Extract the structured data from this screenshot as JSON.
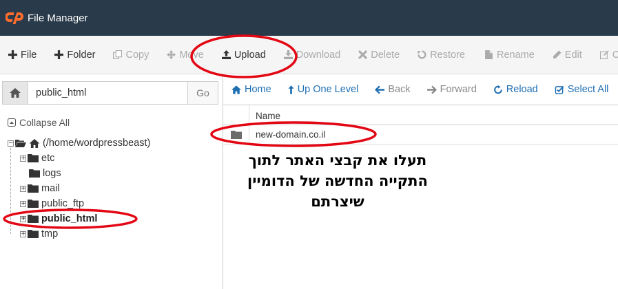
{
  "app": {
    "title": "File Manager",
    "logo_icon": "cpanel-logo"
  },
  "toolbar": {
    "items": [
      {
        "label": "File",
        "icon": "plus-icon",
        "enabled": true
      },
      {
        "label": "Folder",
        "icon": "plus-icon",
        "enabled": true
      },
      {
        "label": "Copy",
        "icon": "copy-icon",
        "enabled": false
      },
      {
        "label": "Move",
        "icon": "move-icon",
        "enabled": false
      },
      {
        "label": "Upload",
        "icon": "upload-icon",
        "enabled": true
      },
      {
        "label": "Download",
        "icon": "download-icon",
        "enabled": false
      },
      {
        "label": "Delete",
        "icon": "delete-icon",
        "enabled": false
      },
      {
        "label": "Restore",
        "icon": "restore-icon",
        "enabled": false
      },
      {
        "label": "Rename",
        "icon": "rename-icon",
        "enabled": false
      },
      {
        "label": "Edit",
        "icon": "edit-icon",
        "enabled": false
      },
      {
        "label": "Co",
        "icon": "code-icon",
        "enabled": false
      }
    ]
  },
  "path": {
    "value": "public_html",
    "go_label": "Go"
  },
  "tree": {
    "collapse_label": "Collapse All",
    "root_label": "(/home/wordpressbeast)",
    "items": [
      {
        "label": "etc",
        "expandable": true,
        "selected": false
      },
      {
        "label": "logs",
        "expandable": false,
        "selected": false
      },
      {
        "label": "mail",
        "expandable": true,
        "selected": false
      },
      {
        "label": "public_ftp",
        "expandable": true,
        "selected": false
      },
      {
        "label": "public_html",
        "expandable": true,
        "selected": true
      },
      {
        "label": "tmp",
        "expandable": true,
        "selected": false
      }
    ]
  },
  "nav": {
    "items": [
      {
        "label": "Home",
        "icon": "home-icon",
        "enabled": true
      },
      {
        "label": "Up One Level",
        "icon": "level-up-icon",
        "enabled": true
      },
      {
        "label": "Back",
        "icon": "arrow-left-icon",
        "enabled": false
      },
      {
        "label": "Forward",
        "icon": "arrow-right-icon",
        "enabled": false
      },
      {
        "label": "Reload",
        "icon": "reload-icon",
        "enabled": true
      },
      {
        "label": "Select All",
        "icon": "check-square-icon",
        "enabled": true
      }
    ]
  },
  "filelist": {
    "column_name": "Name",
    "rows": [
      {
        "name": "new-domain.co.il",
        "type": "folder"
      }
    ]
  },
  "annotation": {
    "lines": [
      "תעלו את קבצי האתר לתוך",
      "התקייה החדשה של הדומיין",
      "שיצרתם"
    ],
    "color": "#e30613"
  },
  "colors": {
    "titlebar": "#293a4a",
    "link": "#1f6fb3",
    "accent_logo": "#ff6c2c"
  }
}
